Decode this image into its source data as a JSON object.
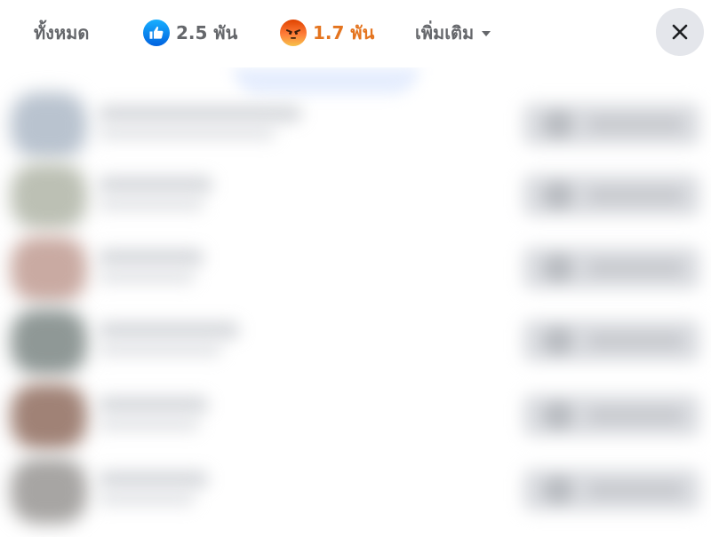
{
  "tabs": {
    "all_label": "ทั้งหมด",
    "like_count": "2.5 พัน",
    "angry_count": "1.7 พัน",
    "more_label": "เพิ่มเติม"
  },
  "icons": {
    "like": "thumbs-up-icon",
    "angry": "angry-face-icon",
    "more": "caret-down-icon",
    "close": "close-icon"
  },
  "colors": {
    "active_tab": "#e4741f",
    "like_blue": "#1877f2",
    "tab_text": "#65676b",
    "close_bg": "#e4e6eb"
  },
  "rows": [
    {
      "avatar": "#b9c3cf"
    },
    {
      "avatar": "#bcc0b4"
    },
    {
      "avatar": "#c9aaa2"
    },
    {
      "avatar": "#8f9896"
    },
    {
      "avatar": "#a08276"
    },
    {
      "avatar": "#a7a5a3"
    }
  ]
}
